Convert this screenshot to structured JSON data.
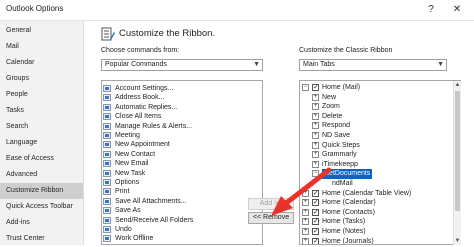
{
  "window": {
    "title": "Outlook Options",
    "help": "?",
    "close": "✕"
  },
  "nav": {
    "items": [
      {
        "label": "General"
      },
      {
        "label": "Mail"
      },
      {
        "label": "Calendar"
      },
      {
        "label": "Groups"
      },
      {
        "label": "People"
      },
      {
        "label": "Tasks"
      },
      {
        "label": "Search"
      },
      {
        "label": "Language"
      },
      {
        "label": "Ease of Access"
      },
      {
        "label": "Advanced"
      },
      {
        "label": "Customize Ribbon",
        "selected": true
      },
      {
        "label": "Quick Access Toolbar"
      },
      {
        "label": "Add-ins"
      },
      {
        "label": "Trust Center"
      }
    ]
  },
  "page": {
    "heading": "Customize the Ribbon."
  },
  "left_panel": {
    "label": "Choose commands from:",
    "dropdown_value": "Popular Commands",
    "commands": [
      {
        "label": "Account Settings...",
        "icon": "account-settings-icon"
      },
      {
        "label": "Address Book...",
        "icon": "address-book-icon"
      },
      {
        "label": "Automatic Replies...",
        "icon": "automatic-replies-icon"
      },
      {
        "label": "Close All Items",
        "icon": "close-all-items-icon"
      },
      {
        "label": "Manage Rules & Alerts...",
        "icon": "rules-icon"
      },
      {
        "label": "Meeting",
        "icon": "meeting-icon"
      },
      {
        "label": "New Appointment",
        "icon": "appointment-icon"
      },
      {
        "label": "New Contact",
        "icon": "contact-icon"
      },
      {
        "label": "New Email",
        "icon": "email-icon"
      },
      {
        "label": "New Task",
        "icon": "task-icon"
      },
      {
        "label": "Options",
        "icon": "options-icon"
      },
      {
        "label": "Print",
        "icon": "print-icon"
      },
      {
        "label": "Save All Attachments...",
        "icon": "attachments-icon"
      },
      {
        "label": "Save As",
        "icon": "save-as-icon"
      },
      {
        "label": "Send/Receive All Folders",
        "icon": "send-receive-icon"
      },
      {
        "label": "Undo",
        "icon": "undo-icon"
      },
      {
        "label": "Work Offline",
        "icon": "work-offline-icon"
      }
    ]
  },
  "middle": {
    "add_label": "Add >>",
    "remove_label": "<< Remove"
  },
  "right_panel": {
    "label": "Customize the Classic Ribbon",
    "dropdown_value": "Main Tabs",
    "tree": [
      {
        "label": "Home (Mail)",
        "level": 0,
        "expander": "−",
        "checked": true
      },
      {
        "label": "New",
        "level": 1,
        "expander": "+"
      },
      {
        "label": "Zoom",
        "level": 1,
        "expander": "+"
      },
      {
        "label": "Delete",
        "level": 1,
        "expander": "+"
      },
      {
        "label": "Respond",
        "level": 1,
        "expander": "+"
      },
      {
        "label": "ND Save",
        "level": 1,
        "expander": "+"
      },
      {
        "label": "Quick Steps",
        "level": 1,
        "expander": "+"
      },
      {
        "label": "Grammarly",
        "level": 1,
        "expander": "+"
      },
      {
        "label": "iTimekeepp",
        "level": 1,
        "expander": "+"
      },
      {
        "label": "NetDocuments",
        "level": 1,
        "expander": "−",
        "selected": true
      },
      {
        "label": "ndMail",
        "level": 2,
        "expander": ""
      },
      {
        "label": "Home (Calendar Table View)",
        "level": 0,
        "expander": "+",
        "checked": true
      },
      {
        "label": "Home (Calendar)",
        "level": 0,
        "expander": "+",
        "checked": true
      },
      {
        "label": "Home (Contacts)",
        "level": 0,
        "expander": "+",
        "checked": true
      },
      {
        "label": "Home (Tasks)",
        "level": 0,
        "expander": "+",
        "checked": true
      },
      {
        "label": "Home (Notes)",
        "level": 0,
        "expander": "+",
        "checked": true
      },
      {
        "label": "Home (Journals)",
        "level": 0,
        "expander": "+",
        "checked": true
      }
    ]
  },
  "colors": {
    "selection": "#0a64c8",
    "nav_selected": "#cfcfcf",
    "arrow": "#e8322b"
  }
}
